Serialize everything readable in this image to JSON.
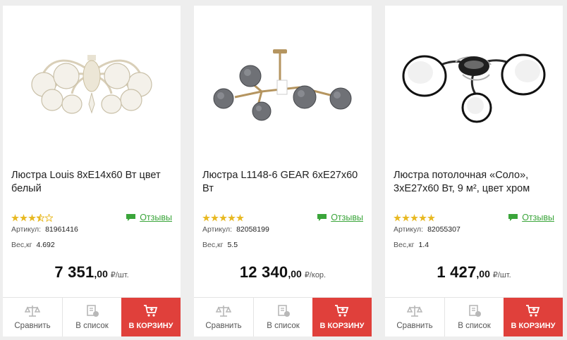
{
  "products": [
    {
      "title": "Люстра Louis 8хЕ14х60 Вт цвет белый",
      "rating_stars": 3.5,
      "reviews_label": "Отзывы",
      "sku_label": "Артикул:",
      "sku": "81961416",
      "weight_label": "Вес,кг",
      "weight": "4.692",
      "price_main": "7 351",
      "price_cents": ",00",
      "price_unit": "₽/шт.",
      "compare_label": "Сравнить",
      "list_label": "В список",
      "cart_label": "В КОРЗИНУ",
      "image_icon": "chandelier-louis-white"
    },
    {
      "title": "Люстра L1148-6 GEAR 6хЕ27х60 Вт",
      "rating_stars": 5,
      "reviews_label": "Отзывы",
      "sku_label": "Артикул:",
      "sku": "82058199",
      "weight_label": "Вес,кг",
      "weight": "5.5",
      "price_main": "12 340",
      "price_cents": ",00",
      "price_unit": "₽/кор.",
      "compare_label": "Сравнить",
      "list_label": "В список",
      "cart_label": "В КОРЗИНУ",
      "image_icon": "chandelier-gear-molecule"
    },
    {
      "title": "Люстра потолочная «Соло», 3хЕ27х60 Вт, 9 м², цвет хром",
      "rating_stars": 5,
      "reviews_label": "Отзывы",
      "sku_label": "Артикул:",
      "sku": "82055307",
      "weight_label": "Вес,кг",
      "weight": "1.4",
      "price_main": "1 427",
      "price_cents": ",00",
      "price_unit": "₽/шт.",
      "compare_label": "Сравнить",
      "list_label": "В список",
      "cart_label": "В КОРЗИНУ",
      "image_icon": "chandelier-solo-chrome"
    }
  ],
  "colors": {
    "accent": "#e0403b",
    "reviews": "#3aa53a",
    "star": "#e8b923"
  }
}
